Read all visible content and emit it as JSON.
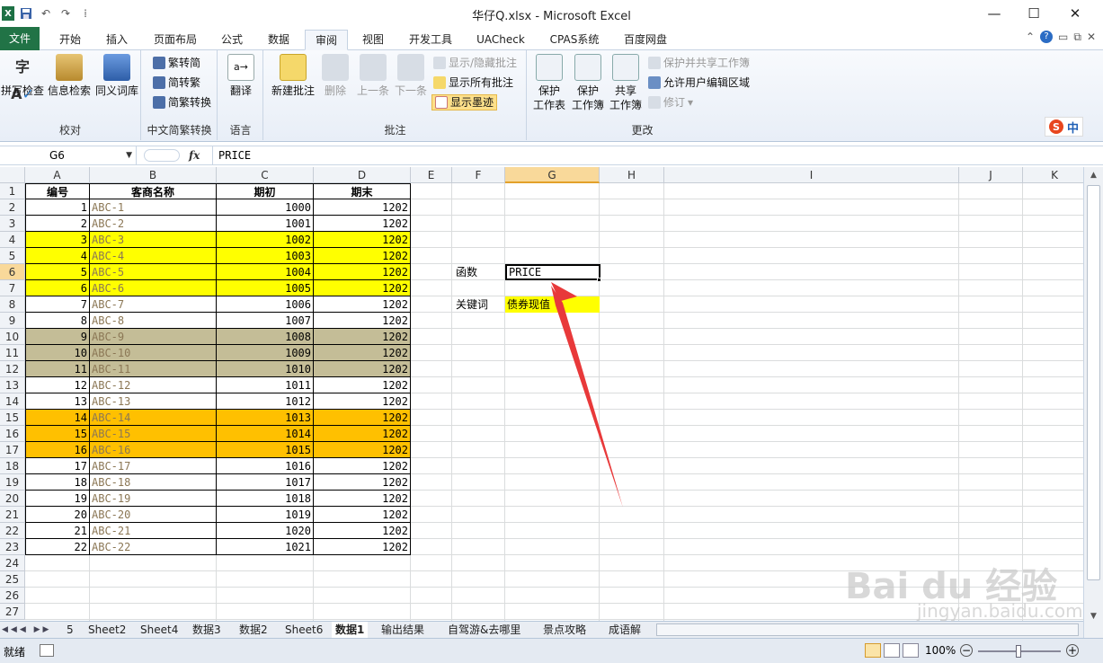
{
  "title_bar": {
    "title": "华仔Q.xlsx - Microsoft Excel",
    "minimize": "—",
    "maximize": "☐",
    "close": "✕"
  },
  "ribbon_tabs": [
    "文件",
    "开始",
    "插入",
    "页面布局",
    "公式",
    "数据",
    "审阅",
    "视图",
    "开发工具",
    "UACheck",
    "CPAS系统",
    "百度网盘"
  ],
  "active_tab": "审阅",
  "ribbon": {
    "proofing": {
      "spell": "拼写检查",
      "research": "信息检索",
      "thesaurus": "同义词库",
      "label": "校对"
    },
    "chinese": {
      "t2s": "繁转简",
      "s2t": "简转繁",
      "convert": "简繁转换",
      "label": "中文简繁转换"
    },
    "language": {
      "translate": "翻译",
      "label": "语言"
    },
    "comments": {
      "new": "新建批注",
      "delete": "删除",
      "prev": "上一条",
      "next": "下一条",
      "show_hide": "显示/隐藏批注",
      "show_all": "显示所有批注",
      "show_ink": "显示墨迹",
      "label": "批注"
    },
    "changes": {
      "protect_sheet_1": "保护",
      "protect_sheet_2": "工作表",
      "protect_wb_1": "保护",
      "protect_wb_2": "工作簿",
      "share_1": "共享",
      "share_2": "工作簿",
      "protect_share": "保护并共享工作簿",
      "allow_edit": "允许用户编辑区域",
      "track": "修订",
      "label": "更改"
    }
  },
  "formula_bar": {
    "name_box": "G6",
    "fx": "fx",
    "value": "PRICE"
  },
  "columns": [
    "A",
    "B",
    "C",
    "D",
    "E",
    "F",
    "G",
    "H",
    "I",
    "J",
    "K"
  ],
  "table": {
    "headers": [
      "编号",
      "客商名称",
      "期初",
      "期末"
    ],
    "rows": [
      [
        "1",
        "ABC-1",
        "1000",
        "1202"
      ],
      [
        "2",
        "ABC-2",
        "1001",
        "1202"
      ],
      [
        "3",
        "ABC-3",
        "1002",
        "1202"
      ],
      [
        "4",
        "ABC-4",
        "1003",
        "1202"
      ],
      [
        "5",
        "ABC-5",
        "1004",
        "1202"
      ],
      [
        "6",
        "ABC-6",
        "1005",
        "1202"
      ],
      [
        "7",
        "ABC-7",
        "1006",
        "1202"
      ],
      [
        "8",
        "ABC-8",
        "1007",
        "1202"
      ],
      [
        "9",
        "ABC-9",
        "1008",
        "1202"
      ],
      [
        "10",
        "ABC-10",
        "1009",
        "1202"
      ],
      [
        "11",
        "ABC-11",
        "1010",
        "1202"
      ],
      [
        "12",
        "ABC-12",
        "1011",
        "1202"
      ],
      [
        "13",
        "ABC-13",
        "1012",
        "1202"
      ],
      [
        "14",
        "ABC-14",
        "1013",
        "1202"
      ],
      [
        "15",
        "ABC-15",
        "1014",
        "1202"
      ],
      [
        "16",
        "ABC-16",
        "1015",
        "1202"
      ],
      [
        "17",
        "ABC-17",
        "1016",
        "1202"
      ],
      [
        "18",
        "ABC-18",
        "1017",
        "1202"
      ],
      [
        "19",
        "ABC-19",
        "1018",
        "1202"
      ],
      [
        "20",
        "ABC-20",
        "1019",
        "1202"
      ],
      [
        "21",
        "ABC-21",
        "1020",
        "1202"
      ],
      [
        "22",
        "ABC-22",
        "1021",
        "1202"
      ]
    ],
    "row_fills": {
      "3": "#ffff00",
      "4": "#ffff00",
      "5": "#ffff00",
      "6": "#ffff00",
      "9": "#c4bd97",
      "10": "#c4bd97",
      "11": "#c4bd97",
      "14": "#ffc000",
      "15": "#ffc000",
      "16": "#ffc000"
    }
  },
  "side_cells": {
    "f6": "函数",
    "g6": "PRICE",
    "f8": "关键词",
    "g8": "债券现值",
    "g8_fill": "#ffff00"
  },
  "sheet_tabs": [
    "5",
    "Sheet2",
    "Sheet4",
    "数据3",
    "数据2",
    "Sheet6",
    "数据1",
    "输出结果",
    "自驾游&去哪里",
    "景点攻略",
    "成语解"
  ],
  "active_sheet": "数据1",
  "status": {
    "ready": "就绪",
    "zoom": "100%"
  },
  "overlay": {
    "arrow_color": "#e8393a",
    "ime": "中",
    "watermark_logo": "Bai du 经验",
    "watermark_url": "jingyan.baidu.com"
  }
}
